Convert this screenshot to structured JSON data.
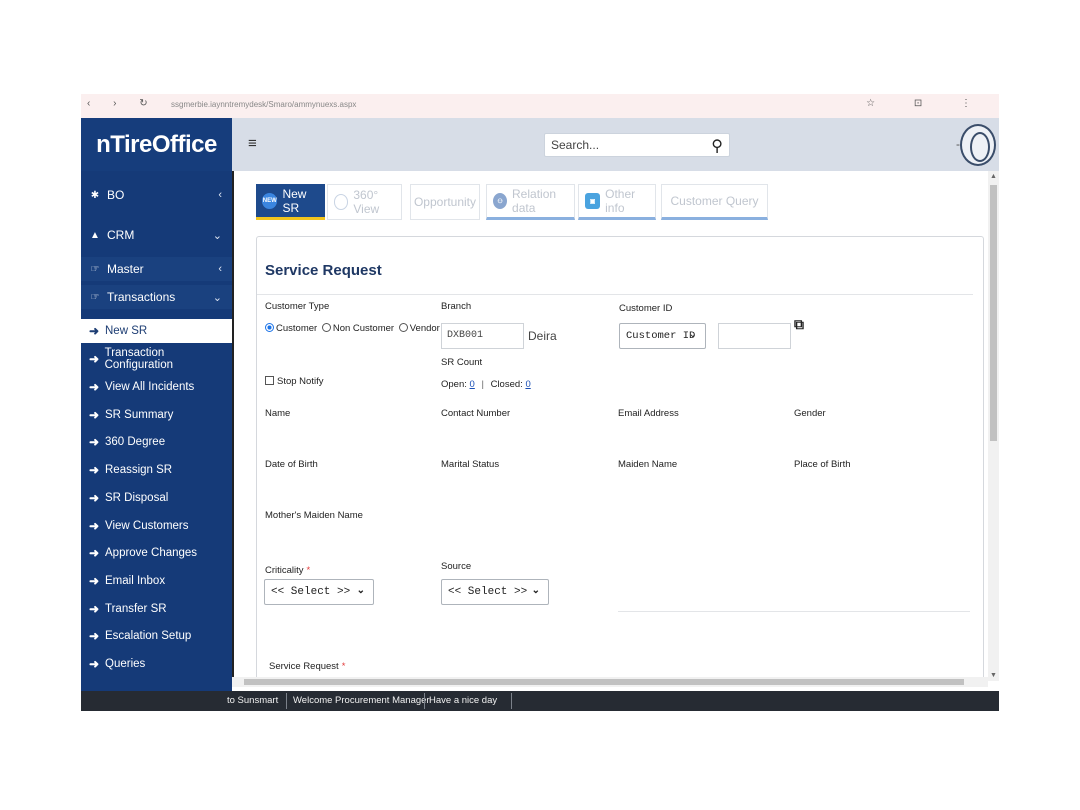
{
  "browser": {
    "url": "ssgmerbie.iaynntremydesk/Smaro/ammynuexs.aspx",
    "nav_icons": "‹ › ↻",
    "right_icons": "☆ ⊡ ⋮"
  },
  "app": {
    "logo": "nTireOffice",
    "search_placeholder": "Search...",
    "user_dash": "-"
  },
  "sidebar": {
    "sections": [
      {
        "label": "BO"
      },
      {
        "label": "CRM"
      },
      {
        "label": "Master"
      },
      {
        "label": "Transactions"
      }
    ],
    "items": [
      {
        "label": "New SR"
      },
      {
        "label": "Transaction Configuration"
      },
      {
        "label": "View All Incidents"
      },
      {
        "label": "SR Summary"
      },
      {
        "label": "360 Degree"
      },
      {
        "label": "Reassign SR"
      },
      {
        "label": "SR Disposal"
      },
      {
        "label": "View Customers"
      },
      {
        "label": "Approve Changes"
      },
      {
        "label": "Email Inbox"
      },
      {
        "label": "Transfer SR"
      },
      {
        "label": "Escalation Setup"
      },
      {
        "label": "Queries"
      }
    ]
  },
  "tabs": [
    {
      "label": "New SR",
      "icon": "new-badge-icon"
    },
    {
      "label": "360° View",
      "icon": "circle-icon"
    },
    {
      "label": "Opportunity",
      "icon": ""
    },
    {
      "label": "Relation data",
      "icon": "relation-icon"
    },
    {
      "label": "Other info",
      "icon": "info-icon"
    },
    {
      "label": "Customer Query",
      "icon": ""
    }
  ],
  "form": {
    "title": "Service Request",
    "customer_type_label": "Customer Type",
    "customer_type_options": [
      "Customer",
      "Non Customer",
      "Vendor"
    ],
    "customer_type_selected": "Customer",
    "branch_label": "Branch",
    "branch_code": "DXB001",
    "branch_name": "Deira",
    "customer_id_label": "Customer ID",
    "customer_id_select": "Customer ID",
    "customer_id_value": "",
    "stop_notify_label": "Stop Notify",
    "sr_count_label": "SR Count",
    "open_label": "Open:",
    "open_value": "0",
    "closed_label": "Closed:",
    "closed_value": "0",
    "name_label": "Name",
    "contact_label": "Contact Number",
    "email_label": "Email Address",
    "gender_label": "Gender",
    "dob_label": "Date of Birth",
    "marital_label": "Marital Status",
    "maiden_label": "Maiden Name",
    "pob_label": "Place of Birth",
    "mother_maiden_label": "Mother's Maiden Name",
    "criticality_label": "Criticality",
    "criticality_value": "<< Select >>",
    "source_label": "Source",
    "source_value": "<< Select >>",
    "service_request_label": "Service Request",
    "required_mark": "*"
  },
  "statusbar": {
    "left": "to Sunsmart",
    "welcome": "Welcome Procurement Manager",
    "greeting": "Have a nice day"
  },
  "colors": {
    "sidebar": "#153a78",
    "active_tab": "#1e4a8c",
    "tab_accent": "#f2c51d",
    "title": "#1f3864"
  }
}
